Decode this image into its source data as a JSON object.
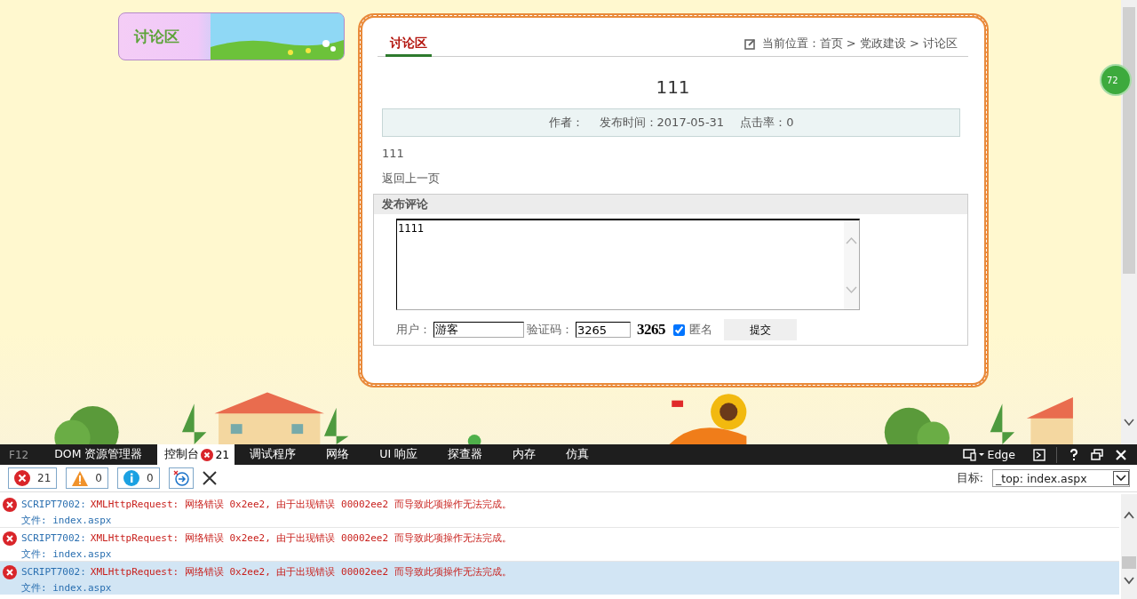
{
  "banner": {
    "title": "讨论区"
  },
  "side_badge": "72",
  "article": {
    "tab": {
      "label": "讨论区",
      "selected": true
    },
    "breadcrumb": "当前位置：首页 > 党政建设 > 讨论区",
    "title": "111",
    "meta": [
      "作者：",
      "发布时间：2017-05-31",
      "点击率：0"
    ],
    "body": "111",
    "back_link": "返回上一页"
  },
  "comment_form": {
    "heading": "发布评论",
    "text": "1111",
    "user_label": "用户：",
    "user_value": "游客",
    "captcha_label": "验证码：",
    "captcha_value": "3265",
    "captcha_image": "3265",
    "anonymous": {
      "label": "匿名",
      "checked": true
    },
    "submit": "提交"
  },
  "devtools": {
    "f12": "F12",
    "tabs": [
      {
        "label": "DOM 资源管理器",
        "selected": false
      },
      {
        "label": "控制台",
        "selected": true,
        "error_count": "21"
      },
      {
        "label": "调试程序",
        "selected": false
      },
      {
        "label": "网络",
        "selected": false
      },
      {
        "label": "UI 响应",
        "selected": false
      },
      {
        "label": "探查器",
        "selected": false
      },
      {
        "label": "内存",
        "selected": false
      },
      {
        "label": "仿真",
        "selected": false
      }
    ],
    "browser_mode": "Edge",
    "filters": [
      {
        "kind": "error",
        "count": "21"
      },
      {
        "kind": "warning",
        "count": "0"
      },
      {
        "kind": "info",
        "count": "0"
      }
    ],
    "target_label": "目标:",
    "target_value": "_top: index.aspx",
    "messages": [
      {
        "code": "SCRIPT7002:",
        "text": "XMLHttpRequest: 网络错误 0x2ee2, 由于出现错误 00002ee2 而导致此项操作无法完成。",
        "file": "文件: index.aspx",
        "selected": false
      },
      {
        "code": "SCRIPT7002:",
        "text": "XMLHttpRequest: 网络错误 0x2ee2, 由于出现错误 00002ee2 而导致此项操作无法完成。",
        "file": "文件: index.aspx",
        "selected": false
      },
      {
        "code": "SCRIPT7002:",
        "text": "XMLHttpRequest: 网络错误 0x2ee2, 由于出现错误 00002ee2 而导致此项操作无法完成。",
        "file": "文件: index.aspx",
        "selected": true
      }
    ]
  }
}
